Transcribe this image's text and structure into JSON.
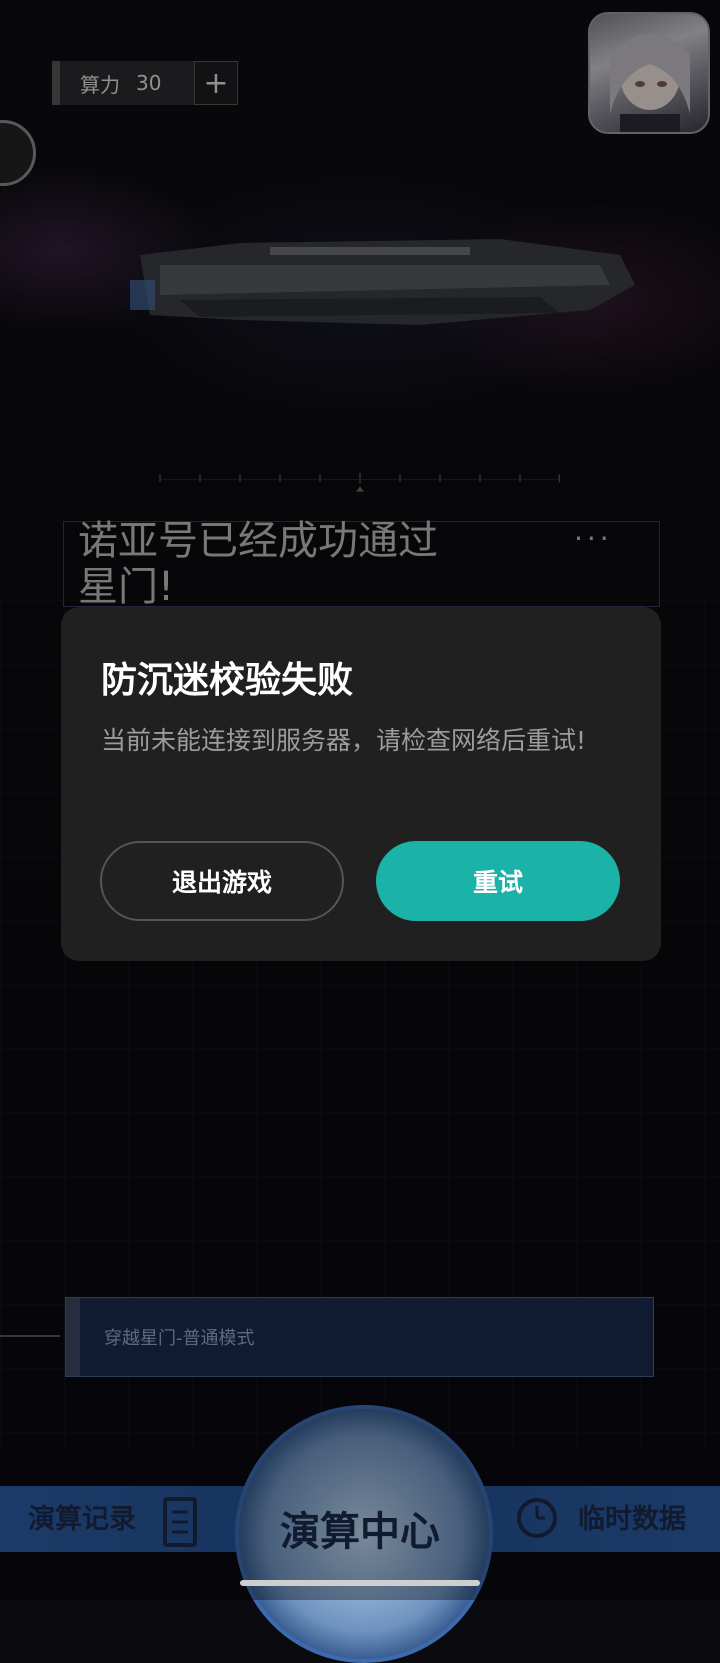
{
  "hud": {
    "compute_label": "算力",
    "compute_value": "30",
    "compute_plus": "+"
  },
  "mission": {
    "text": "诺亚号已经成功通过星门!",
    "more": "···"
  },
  "mode": {
    "label": "穿越星门-普通模式"
  },
  "nav": {
    "record_label": "演算记录",
    "center_label": "演算中心",
    "temp_label": "临时数据"
  },
  "dialog": {
    "title": "防沉迷校验失败",
    "message": "当前未能连接到服务器，请检查网络后重试!",
    "exit_label": "退出游戏",
    "retry_label": "重试"
  },
  "colors": {
    "accent": "#1bb3a7",
    "dialog_bg": "#202020",
    "nav_band": "#2c5aa0"
  }
}
